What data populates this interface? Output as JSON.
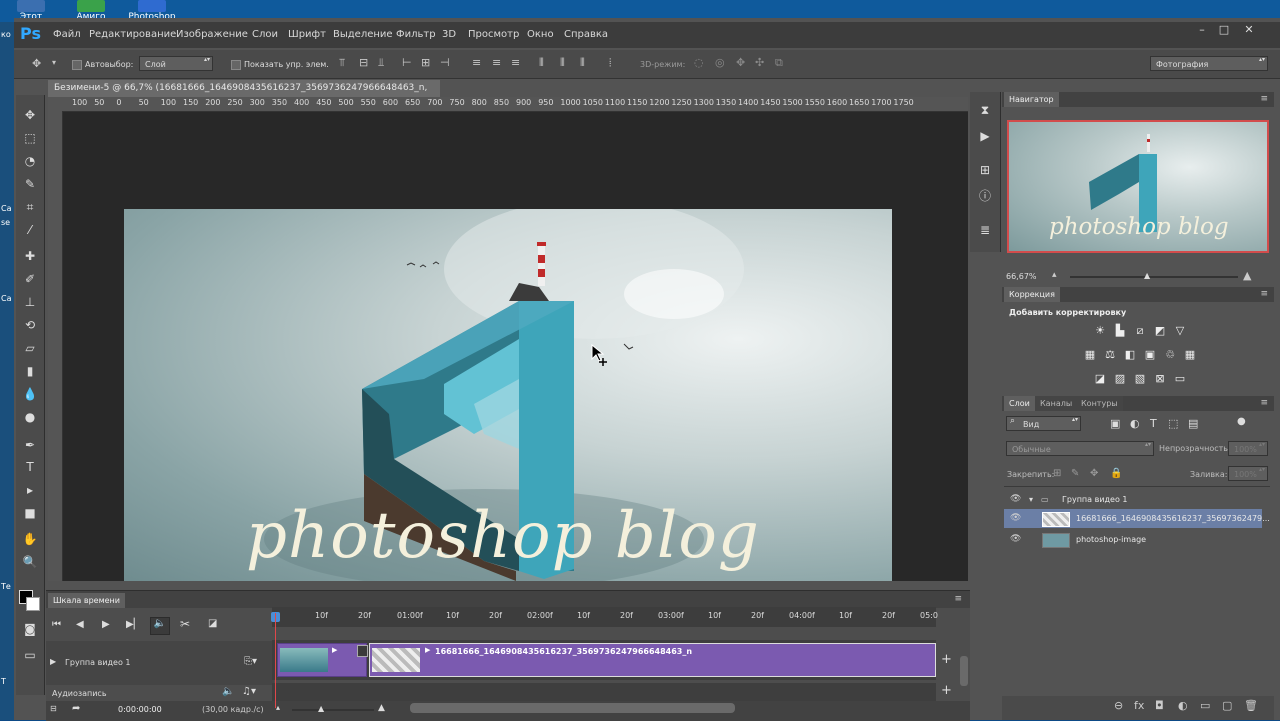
{
  "desktop": {
    "icons": [
      {
        "label": "Этот",
        "color": "#3b6fb0"
      },
      {
        "label": "Амиго",
        "color": "#3aa24a"
      },
      {
        "label": "Photoshop",
        "color": "#2f6bd0"
      }
    ],
    "left_labels": [
      "ко",
      "Са",
      "se",
      "Са",
      "Те",
      "Т"
    ]
  },
  "app": {
    "logo": "Ps",
    "menu": [
      "Файл",
      "Редактирование",
      "Изображение",
      "Слои",
      "Шрифт",
      "Выделение",
      "Фильтр",
      "3D",
      "Просмотр",
      "Окно",
      "Справка"
    ],
    "window_buttons": [
      "–",
      "□",
      "✕"
    ]
  },
  "options": {
    "autoselect_label": "Автовыбор:",
    "autoselect_value": "Слой",
    "show_controls_label": "Показать упр. элем.",
    "mode3d_label": "3D-режим:",
    "workspace_value": "Фотография"
  },
  "document": {
    "tab_title": "Безимени-5 @ 66,7% (16681666_1646908435616237_3569736247966648463_n, RGB/8#) *",
    "tab_close": "×",
    "ruler_top": [
      "100",
      "50",
      "0",
      "50",
      "100",
      "150",
      "200",
      "250",
      "300",
      "350",
      "400",
      "450",
      "500",
      "550",
      "600",
      "650",
      "700",
      "750",
      "800",
      "850",
      "900",
      "950",
      "1000",
      "1050",
      "1100",
      "1150",
      "1200",
      "1250",
      "1300",
      "1350",
      "1400",
      "1450",
      "1500",
      "1550",
      "1600",
      "1650",
      "1700",
      "1750"
    ],
    "canvas_text": "photoshop blog"
  },
  "navigator": {
    "title": "Навигатор",
    "thumb_text": "photoshop blog",
    "zoom": "66,67%"
  },
  "corrections": {
    "title": "Коррекция",
    "subtitle": "Добавить корректировку"
  },
  "layers": {
    "tabs": [
      "Слои",
      "Каналы",
      "Контуры"
    ],
    "filter_value": "Вид",
    "blend_mode": "Обычные",
    "opacity_label": "Непрозрачность:",
    "opacity_value": "100%",
    "lock_label": "Закрепить:",
    "fill_label": "Заливка:",
    "fill_value": "100%",
    "items": [
      {
        "name": "Группа видео 1",
        "type": "group"
      },
      {
        "name": "16681666_1646908435616237_35697362479...",
        "type": "layer",
        "selected": true
      },
      {
        "name": "photoshop-image",
        "type": "layer"
      }
    ]
  },
  "timeline": {
    "title": "Шкала времени",
    "ticks": [
      "10f",
      "20f",
      "01:00f",
      "10f",
      "20f",
      "02:00f",
      "10f",
      "20f",
      "03:00f",
      "10f",
      "20f",
      "04:00f",
      "10f",
      "20f",
      "05:0"
    ],
    "track_name": "Группа видео 1",
    "audio_name": "Аудиозапись",
    "clip_label": "16681666_1646908435616237_3569736247966648463_n",
    "current_time": "0:00:00:00",
    "fps": "(30,00 кадр./с)"
  }
}
